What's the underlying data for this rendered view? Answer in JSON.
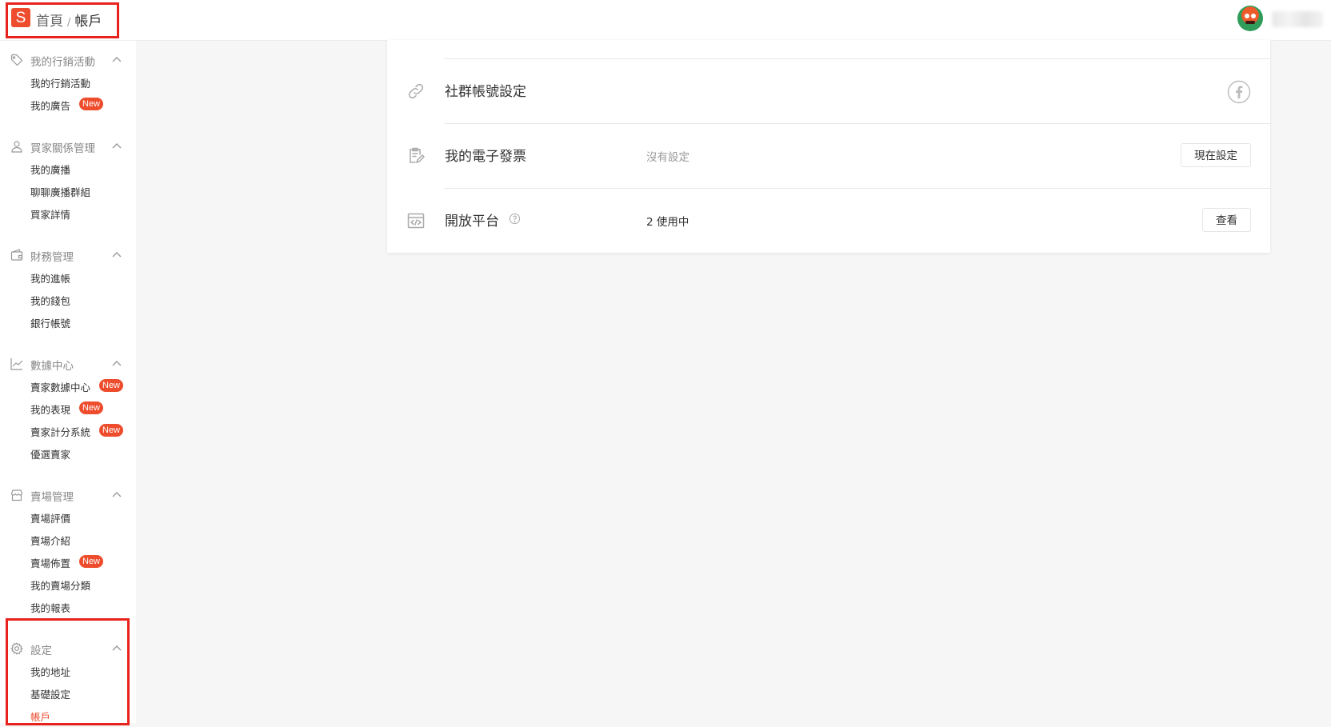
{
  "header": {
    "logo_text": "S",
    "breadcrumb": {
      "home": "首頁",
      "separator": "/",
      "current": "帳戶"
    }
  },
  "sidebar": {
    "groups": [
      {
        "title": "我的行銷活動",
        "icon": "tag-icon",
        "items": [
          {
            "label": "我的行銷活動"
          },
          {
            "label": "我的廣告",
            "badge": "New"
          }
        ]
      },
      {
        "title": "買家關係管理",
        "icon": "user-icon",
        "items": [
          {
            "label": "我的廣播"
          },
          {
            "label": "聊聊廣播群組"
          },
          {
            "label": "買家詳情"
          }
        ]
      },
      {
        "title": "財務管理",
        "icon": "wallet-icon",
        "items": [
          {
            "label": "我的進帳"
          },
          {
            "label": "我的錢包"
          },
          {
            "label": "銀行帳號"
          }
        ]
      },
      {
        "title": "數據中心",
        "icon": "chart-icon",
        "items": [
          {
            "label": "賣家數據中心",
            "badge": "New"
          },
          {
            "label": "我的表現",
            "badge": "New"
          },
          {
            "label": "賣家計分系統",
            "badge": "New"
          },
          {
            "label": "優選賣家"
          }
        ]
      },
      {
        "title": "賣場管理",
        "icon": "shop-icon",
        "items": [
          {
            "label": "賣場評價"
          },
          {
            "label": "賣場介紹"
          },
          {
            "label": "賣場佈置",
            "badge": "New"
          },
          {
            "label": "我的賣場分類"
          },
          {
            "label": "我的報表"
          }
        ]
      },
      {
        "title": "設定",
        "icon": "gear-icon",
        "items": [
          {
            "label": "我的地址"
          },
          {
            "label": "基礎設定"
          },
          {
            "label": "帳戶",
            "active": true
          }
        ]
      }
    ]
  },
  "account": {
    "rows": [
      {
        "title": "社群帳號設定",
        "icon": "link-icon",
        "action_icon": "facebook-icon"
      },
      {
        "title": "我的電子發票",
        "icon": "invoice-icon",
        "value": "沒有設定",
        "button": "現在設定"
      },
      {
        "title": "開放平台",
        "icon": "code-window-icon",
        "value": "2 使用中",
        "button": "查看",
        "help_icon": "help-icon"
      }
    ]
  },
  "colors": {
    "accent": "#ee4d2d",
    "highlight": "#e8231d"
  }
}
